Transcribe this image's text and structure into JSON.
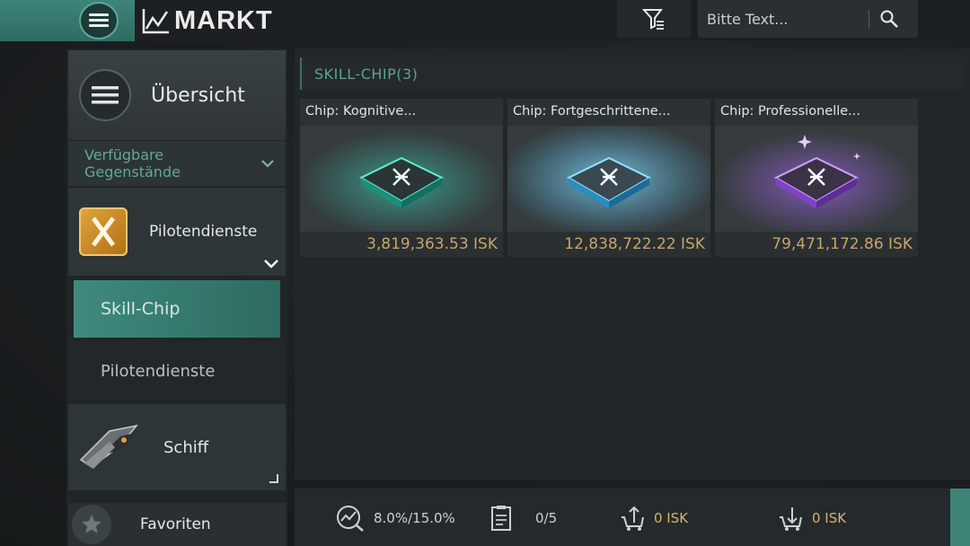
{
  "header": {
    "title": "MARKT",
    "search_placeholder": "Bitte Text..."
  },
  "sidebar": {
    "overview_label": "Übersicht",
    "dropdown_label": "Verfügbare Gegenstände",
    "category_label": "Pilotendienste",
    "sub_items": [
      {
        "label": "Skill-Chip",
        "selected": true
      },
      {
        "label": "Pilotendienste",
        "selected": false
      }
    ],
    "ship_label": "Schiff",
    "favorites_label": "Favoriten"
  },
  "main": {
    "section_title": "SKILL-CHIP(3)",
    "items": [
      {
        "name": "Chip: Kognitive...",
        "price": "3,819,363.53 ISK",
        "glow": "#3ee0c0"
      },
      {
        "name": "Chip: Fortgeschrittene...",
        "price": "12,838,722.22 ISK",
        "glow": "#58c8ff"
      },
      {
        "name": "Chip: Professionelle...",
        "price": "79,471,172.86 ISK",
        "glow": "#b26bff"
      }
    ]
  },
  "footer": {
    "tax": "8.0%/15.0%",
    "orders": "0/5",
    "sell_value": "0 ISK",
    "buy_value": "0 ISK"
  },
  "colors": {
    "accent": "#3f8a7d",
    "price": "#c9a46a"
  }
}
